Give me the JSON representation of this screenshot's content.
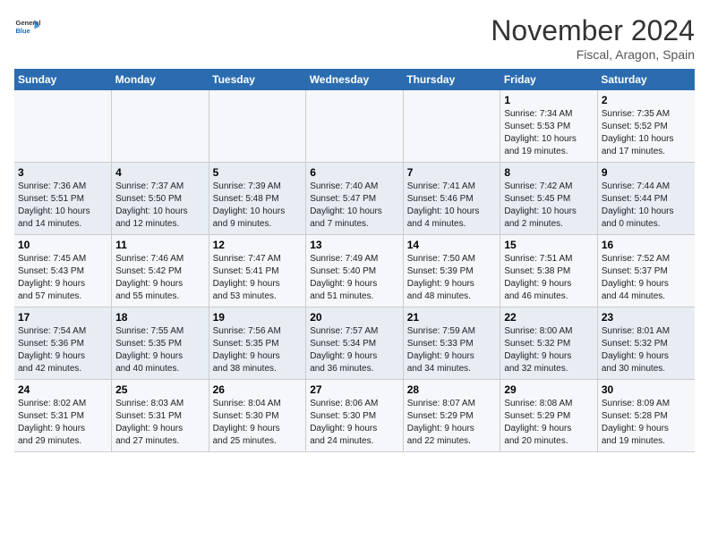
{
  "header": {
    "logo_line1": "General",
    "logo_line2": "Blue",
    "month": "November 2024",
    "location": "Fiscal, Aragon, Spain"
  },
  "weekdays": [
    "Sunday",
    "Monday",
    "Tuesday",
    "Wednesday",
    "Thursday",
    "Friday",
    "Saturday"
  ],
  "weeks": [
    [
      {
        "day": "",
        "info": ""
      },
      {
        "day": "",
        "info": ""
      },
      {
        "day": "",
        "info": ""
      },
      {
        "day": "",
        "info": ""
      },
      {
        "day": "",
        "info": ""
      },
      {
        "day": "1",
        "info": "Sunrise: 7:34 AM\nSunset: 5:53 PM\nDaylight: 10 hours\nand 19 minutes."
      },
      {
        "day": "2",
        "info": "Sunrise: 7:35 AM\nSunset: 5:52 PM\nDaylight: 10 hours\nand 17 minutes."
      }
    ],
    [
      {
        "day": "3",
        "info": "Sunrise: 7:36 AM\nSunset: 5:51 PM\nDaylight: 10 hours\nand 14 minutes."
      },
      {
        "day": "4",
        "info": "Sunrise: 7:37 AM\nSunset: 5:50 PM\nDaylight: 10 hours\nand 12 minutes."
      },
      {
        "day": "5",
        "info": "Sunrise: 7:39 AM\nSunset: 5:48 PM\nDaylight: 10 hours\nand 9 minutes."
      },
      {
        "day": "6",
        "info": "Sunrise: 7:40 AM\nSunset: 5:47 PM\nDaylight: 10 hours\nand 7 minutes."
      },
      {
        "day": "7",
        "info": "Sunrise: 7:41 AM\nSunset: 5:46 PM\nDaylight: 10 hours\nand 4 minutes."
      },
      {
        "day": "8",
        "info": "Sunrise: 7:42 AM\nSunset: 5:45 PM\nDaylight: 10 hours\nand 2 minutes."
      },
      {
        "day": "9",
        "info": "Sunrise: 7:44 AM\nSunset: 5:44 PM\nDaylight: 10 hours\nand 0 minutes."
      }
    ],
    [
      {
        "day": "10",
        "info": "Sunrise: 7:45 AM\nSunset: 5:43 PM\nDaylight: 9 hours\nand 57 minutes."
      },
      {
        "day": "11",
        "info": "Sunrise: 7:46 AM\nSunset: 5:42 PM\nDaylight: 9 hours\nand 55 minutes."
      },
      {
        "day": "12",
        "info": "Sunrise: 7:47 AM\nSunset: 5:41 PM\nDaylight: 9 hours\nand 53 minutes."
      },
      {
        "day": "13",
        "info": "Sunrise: 7:49 AM\nSunset: 5:40 PM\nDaylight: 9 hours\nand 51 minutes."
      },
      {
        "day": "14",
        "info": "Sunrise: 7:50 AM\nSunset: 5:39 PM\nDaylight: 9 hours\nand 48 minutes."
      },
      {
        "day": "15",
        "info": "Sunrise: 7:51 AM\nSunset: 5:38 PM\nDaylight: 9 hours\nand 46 minutes."
      },
      {
        "day": "16",
        "info": "Sunrise: 7:52 AM\nSunset: 5:37 PM\nDaylight: 9 hours\nand 44 minutes."
      }
    ],
    [
      {
        "day": "17",
        "info": "Sunrise: 7:54 AM\nSunset: 5:36 PM\nDaylight: 9 hours\nand 42 minutes."
      },
      {
        "day": "18",
        "info": "Sunrise: 7:55 AM\nSunset: 5:35 PM\nDaylight: 9 hours\nand 40 minutes."
      },
      {
        "day": "19",
        "info": "Sunrise: 7:56 AM\nSunset: 5:35 PM\nDaylight: 9 hours\nand 38 minutes."
      },
      {
        "day": "20",
        "info": "Sunrise: 7:57 AM\nSunset: 5:34 PM\nDaylight: 9 hours\nand 36 minutes."
      },
      {
        "day": "21",
        "info": "Sunrise: 7:59 AM\nSunset: 5:33 PM\nDaylight: 9 hours\nand 34 minutes."
      },
      {
        "day": "22",
        "info": "Sunrise: 8:00 AM\nSunset: 5:32 PM\nDaylight: 9 hours\nand 32 minutes."
      },
      {
        "day": "23",
        "info": "Sunrise: 8:01 AM\nSunset: 5:32 PM\nDaylight: 9 hours\nand 30 minutes."
      }
    ],
    [
      {
        "day": "24",
        "info": "Sunrise: 8:02 AM\nSunset: 5:31 PM\nDaylight: 9 hours\nand 29 minutes."
      },
      {
        "day": "25",
        "info": "Sunrise: 8:03 AM\nSunset: 5:31 PM\nDaylight: 9 hours\nand 27 minutes."
      },
      {
        "day": "26",
        "info": "Sunrise: 8:04 AM\nSunset: 5:30 PM\nDaylight: 9 hours\nand 25 minutes."
      },
      {
        "day": "27",
        "info": "Sunrise: 8:06 AM\nSunset: 5:30 PM\nDaylight: 9 hours\nand 24 minutes."
      },
      {
        "day": "28",
        "info": "Sunrise: 8:07 AM\nSunset: 5:29 PM\nDaylight: 9 hours\nand 22 minutes."
      },
      {
        "day": "29",
        "info": "Sunrise: 8:08 AM\nSunset: 5:29 PM\nDaylight: 9 hours\nand 20 minutes."
      },
      {
        "day": "30",
        "info": "Sunrise: 8:09 AM\nSunset: 5:28 PM\nDaylight: 9 hours\nand 19 minutes."
      }
    ]
  ]
}
